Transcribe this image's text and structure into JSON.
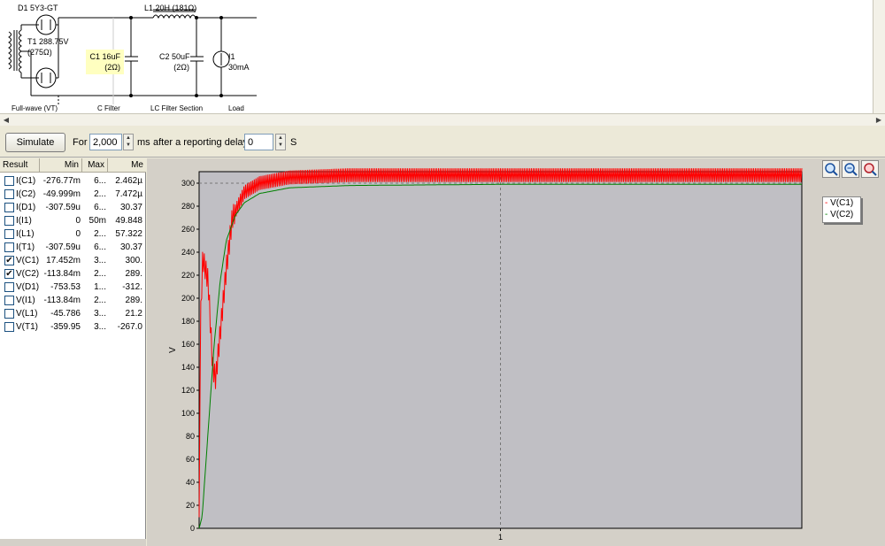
{
  "schematic": {
    "d1": "D1  5Y3-GT",
    "l1": "L1  20H (181Ω)",
    "t1_line1": "T1  288.75V",
    "t1_line2": "(275Ω)",
    "c1_line1": "C1  16uF",
    "c1_line2": "(2Ω)",
    "c2_line1": "C2  50uF",
    "c2_line2": "(2Ω)",
    "i1_line1": "I1",
    "i1_line2": "30mA",
    "section_fullwave": "Full-wave (VT)",
    "section_cfilter": "C Filter",
    "section_lc": "LC Filter Section",
    "section_load": "Load",
    "highlight_color": "#ffffc0"
  },
  "toolbar": {
    "simulate_label": "Simulate",
    "for_label": "For",
    "duration_value": "2,000",
    "ms_label": "ms",
    "delay_label": "after a reporting delay of",
    "delay_value": "0",
    "s_label": "S"
  },
  "results": {
    "columns": [
      "Result",
      "Min",
      "Max",
      "Me"
    ],
    "rows": [
      {
        "name": "I(C1)",
        "min": "-276.77m",
        "max": "6...",
        "mean": "2.462µ",
        "checked": false
      },
      {
        "name": "I(C2)",
        "min": "-49.999m",
        "max": "2...",
        "mean": "7.472µ",
        "checked": false
      },
      {
        "name": "I(D1)",
        "min": "-307.59u",
        "max": "6...",
        "mean": "30.37",
        "checked": false
      },
      {
        "name": "I(I1)",
        "min": "0",
        "max": "50m",
        "mean": "49.848",
        "checked": false
      },
      {
        "name": "I(L1)",
        "min": "0",
        "max": "2...",
        "mean": "57.322",
        "checked": false
      },
      {
        "name": "I(T1)",
        "min": "-307.59u",
        "max": "6...",
        "mean": "30.37",
        "checked": false
      },
      {
        "name": "V(C1)",
        "min": "17.452m",
        "max": "3...",
        "mean": "300.",
        "checked": true
      },
      {
        "name": "V(C2)",
        "min": "-113.84m",
        "max": "2...",
        "mean": "289.",
        "checked": true
      },
      {
        "name": "V(D1)",
        "min": "-753.53",
        "max": "1...",
        "mean": "-312.",
        "checked": false
      },
      {
        "name": "V(I1)",
        "min": "-113.84m",
        "max": "2...",
        "mean": "289.",
        "checked": false
      },
      {
        "name": "V(L1)",
        "min": "-45.786",
        "max": "3...",
        "mean": "21.2",
        "checked": false
      },
      {
        "name": "V(T1)",
        "min": "-359.95",
        "max": "3...",
        "mean": "-267.0",
        "checked": false
      }
    ]
  },
  "plot": {
    "zoom_icons": [
      "zoom-in-icon",
      "zoom-fit-icon",
      "zoom-out-icon"
    ]
  },
  "chart_data": {
    "type": "line",
    "ylabel": "V",
    "xlim": [
      0,
      2
    ],
    "ylim": [
      0,
      310
    ],
    "yticks": [
      0,
      20,
      40,
      60,
      80,
      100,
      120,
      140,
      160,
      180,
      200,
      220,
      240,
      260,
      280,
      300
    ],
    "xticks": [
      1
    ],
    "xtick_labels": [
      "1"
    ],
    "grid": true,
    "legend_position": "top-right",
    "series": [
      {
        "name": "V(C1)",
        "color": "#ff0000",
        "ripple_amplitude": 8,
        "envelope": [
          [
            0,
            0
          ],
          [
            0.004,
            175
          ],
          [
            0.012,
            235
          ],
          [
            0.03,
            215
          ],
          [
            0.045,
            140
          ],
          [
            0.055,
            130
          ],
          [
            0.07,
            170
          ],
          [
            0.09,
            225
          ],
          [
            0.11,
            270
          ],
          [
            0.15,
            292
          ],
          [
            0.2,
            300
          ],
          [
            0.3,
            305
          ],
          [
            0.5,
            307
          ],
          [
            1.0,
            307
          ],
          [
            2.0,
            307
          ]
        ]
      },
      {
        "name": "V(C2)",
        "color": "#008000",
        "ripple_amplitude": 0,
        "envelope": [
          [
            0,
            0
          ],
          [
            0.01,
            10
          ],
          [
            0.03,
            85
          ],
          [
            0.05,
            160
          ],
          [
            0.07,
            215
          ],
          [
            0.09,
            250
          ],
          [
            0.12,
            272
          ],
          [
            0.15,
            283
          ],
          [
            0.2,
            291
          ],
          [
            0.3,
            296
          ],
          [
            0.5,
            298
          ],
          [
            1.0,
            299
          ],
          [
            2.0,
            299
          ]
        ]
      }
    ]
  }
}
